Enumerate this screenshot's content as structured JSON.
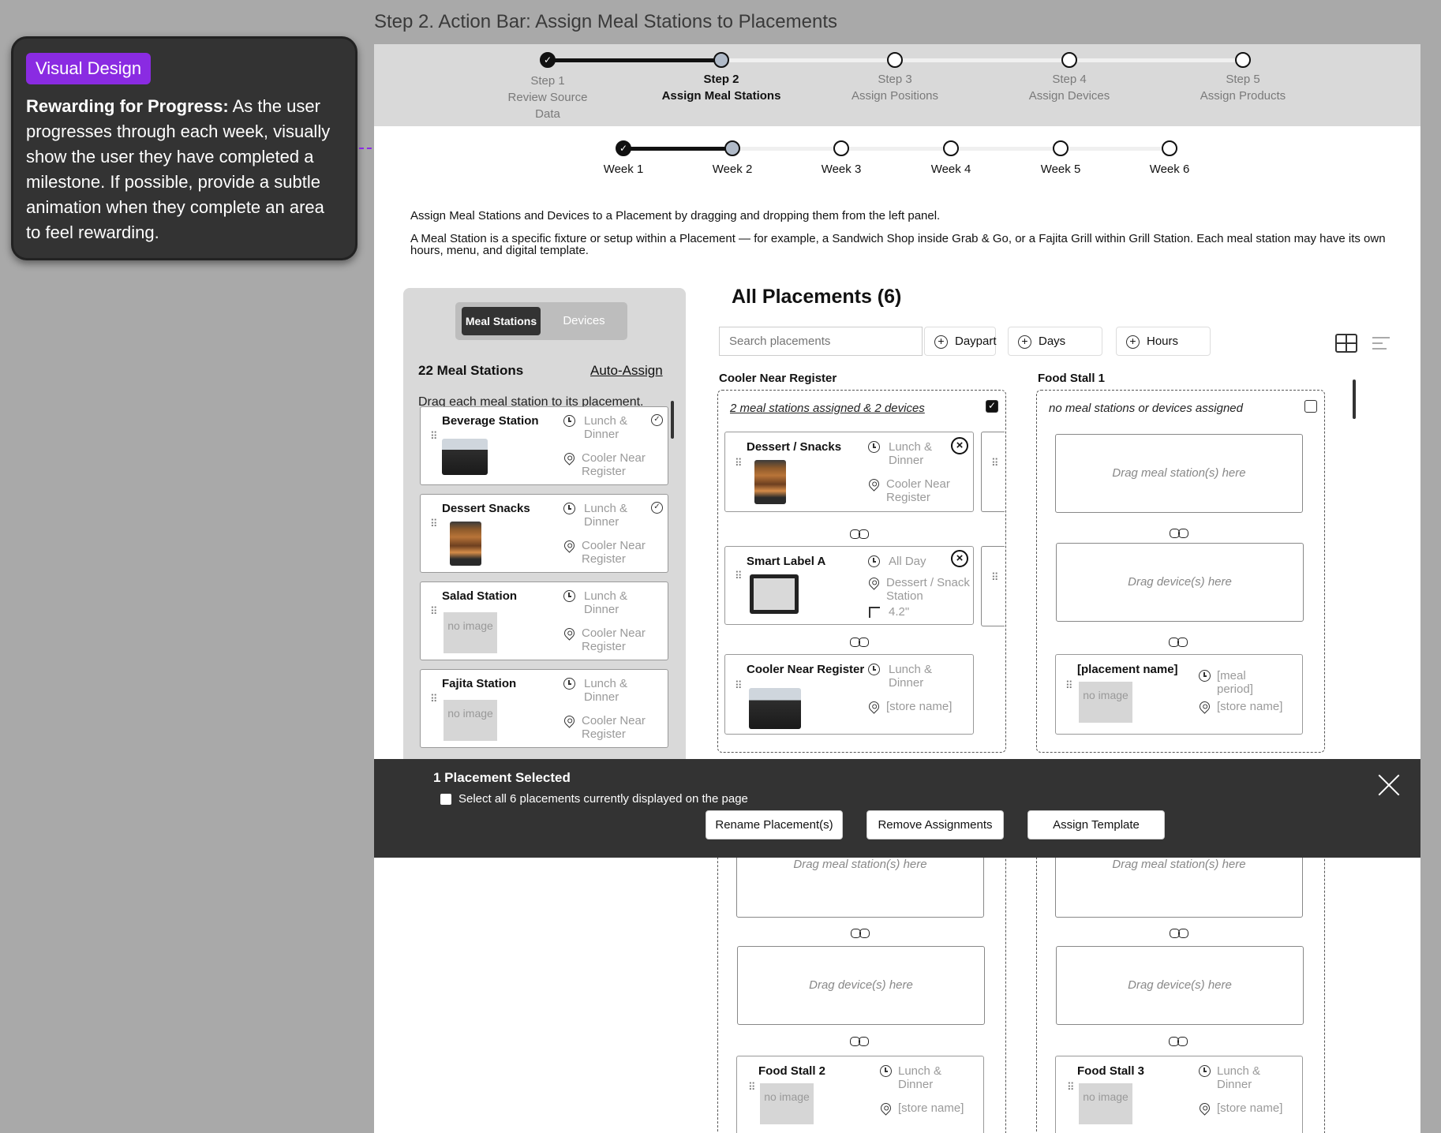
{
  "frame_title": "Step 2. Action Bar: Assign Meal Stations to Placements",
  "note": {
    "badge": "Visual Design",
    "heading": "Rewarding for Progress:",
    "body": " As the user progresses through each week, visually show the user they have completed a milestone. If possible, provide a subtle animation when they complete an area to feel rewarding."
  },
  "steps": [
    {
      "num": "Step 1",
      "label": "Review Source Data",
      "state": "done"
    },
    {
      "num": "Step 2",
      "label": "Assign Meal Stations",
      "state": "current"
    },
    {
      "num": "Step 3",
      "label": "Assign Positions",
      "state": "todo"
    },
    {
      "num": "Step 4",
      "label": "Assign Devices",
      "state": "todo"
    },
    {
      "num": "Step 5",
      "label": "Assign Products",
      "state": "todo"
    }
  ],
  "weeks": [
    {
      "label": "Week 1",
      "state": "done"
    },
    {
      "label": "Week 2",
      "state": "current"
    },
    {
      "label": "Week 3",
      "state": "todo"
    },
    {
      "label": "Week 4",
      "state": "todo"
    },
    {
      "label": "Week 5",
      "state": "todo"
    },
    {
      "label": "Week 6",
      "state": "todo"
    }
  ],
  "instructions": {
    "line1": "Assign Meal Stations and Devices to a Placement by dragging and dropping them from the left panel.",
    "line2": "A Meal Station is a specific fixture or setup within a Placement — for example, a Sandwich Shop inside Grab & Go, or a Fajita Grill within Grill Station. Each meal station may have its own hours, menu, and digital template."
  },
  "left_panel": {
    "tab_meal": "Meal Stations",
    "tab_devices": "Devices",
    "count": "22 Meal Stations",
    "auto_assign": "Auto-Assign",
    "hint": "Drag each meal station to its placement.",
    "cards": [
      {
        "title": "Beverage Station",
        "period": "Lunch & Dinner",
        "place": "Cooler Near Register",
        "image": "cooler-fixture",
        "assigned": true
      },
      {
        "title": "Dessert Snacks",
        "period": "Lunch & Dinner",
        "place": "Cooler Near Register",
        "image": "bakery-case",
        "assigned": true
      },
      {
        "title": "Salad Station",
        "period": "Lunch & Dinner",
        "place": "Cooler Near Register",
        "image": "no image",
        "assigned": false
      },
      {
        "title": "Fajita Station",
        "period": "Lunch & Dinner",
        "place": "Cooler Near Register",
        "image": "no image",
        "assigned": false
      }
    ]
  },
  "placements": {
    "title": "All Placements (6)",
    "search_placeholder": "Search placements",
    "filters": [
      "Daypart",
      "Days",
      "Hours"
    ],
    "col1": {
      "label": "Cooler Near Register",
      "summary": "2 meal stations assigned & 2 devices",
      "checked": true,
      "station": {
        "title": "Dessert / Snacks",
        "period": "Lunch & Dinner",
        "place": "Cooler Near Register"
      },
      "device": {
        "title": "Smart Label A",
        "period": "All Day",
        "place": "Dessert / Snack Station",
        "size": "4.2\""
      },
      "footer": {
        "title": "Cooler Near Register",
        "period": "Lunch & Dinner",
        "place": "[store name]"
      }
    },
    "col2": {
      "label": "Food Stall 1",
      "summary": "no meal stations or devices assigned",
      "checked": false,
      "drop_station": "Drag meal station(s) here",
      "drop_device": "Drag device(s) here",
      "footer": {
        "title": "[placement name]",
        "period": "[meal period]",
        "place": "[store name]",
        "image": "no image"
      }
    },
    "col3": {
      "drop_station": "Drag meal station(s) here",
      "drop_device": "Drag device(s) here",
      "footer": {
        "title": "Food Stall 2",
        "period": "Lunch & Dinner",
        "place": "[store name]",
        "image": "no image"
      }
    },
    "col4": {
      "drop_station": "Drag meal station(s) here",
      "drop_device": "Drag device(s) here",
      "footer": {
        "title": "Food Stall 3",
        "period": "Lunch & Dinner",
        "place": "[store name]",
        "image": "no image"
      }
    }
  },
  "action_bar": {
    "title": "1 Placement Selected",
    "select_all": "Select all 6 placements currently displayed on the page",
    "buttons": [
      "Rename Placement(s)",
      "Remove Assignments",
      "Assign Template"
    ]
  },
  "colors": {
    "accent": "#8a2be2",
    "action_bar": "#333333",
    "stepper_bg": "#d9d9d9"
  }
}
